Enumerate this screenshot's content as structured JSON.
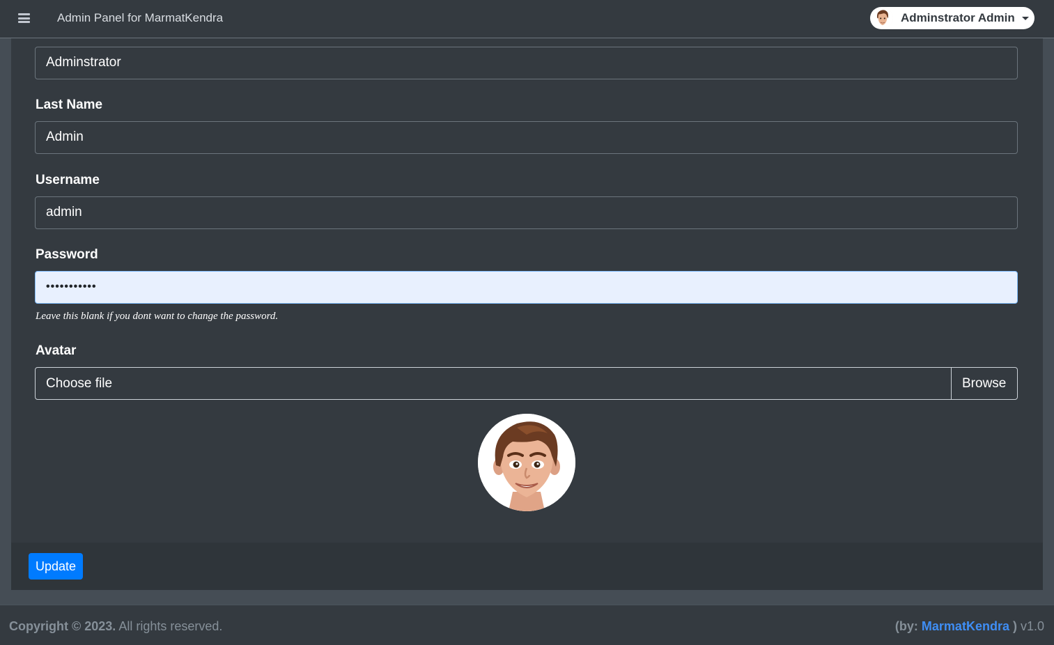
{
  "navbar": {
    "menu_icon": "hamburger-icon",
    "brand": "Admin Panel for MarmatKendra",
    "user_name": "Adminstrator Admin",
    "dropdown_icon": "caret-down-icon"
  },
  "form": {
    "first_name_value": "Adminstrator",
    "last_name_label": "Last Name",
    "last_name_value": "Admin",
    "username_label": "Username",
    "username_value": "admin",
    "password_label": "Password",
    "password_value": "•••••••••••",
    "password_help": "Leave this blank if you dont want to change the password.",
    "avatar_label": "Avatar",
    "file_placeholder": "Choose file",
    "browse_label": "Browse",
    "submit_label": "Update"
  },
  "footer": {
    "copyright_bold": "Copyright © 2023.",
    "copyright_rest": " All rights reserved.",
    "credits_prefix": "(by: ",
    "credits_link": "MarmatKendra",
    "credits_suffix": " )",
    "version": " v1.0"
  },
  "colors": {
    "accent": "#007bff",
    "link": "#3f8ef5",
    "navbar_bg": "#343a40",
    "page_bg": "#454d55"
  }
}
